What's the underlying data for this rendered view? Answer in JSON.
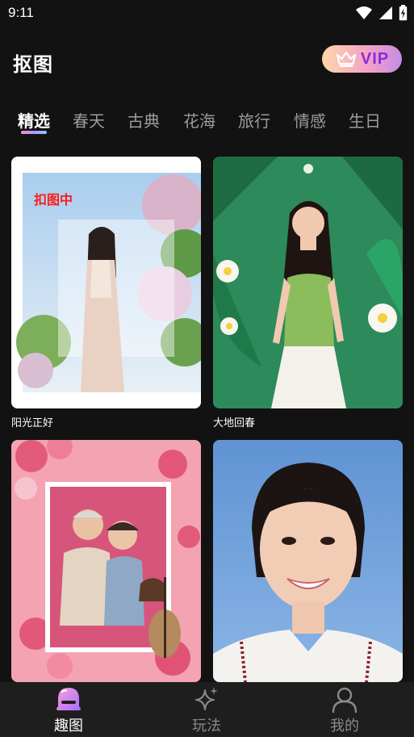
{
  "status": {
    "time": "9:11"
  },
  "header": {
    "title": "抠图",
    "vip_label": "VIP"
  },
  "tabs": [
    {
      "label": "精选",
      "active": true
    },
    {
      "label": "春天"
    },
    {
      "label": "古典"
    },
    {
      "label": "花海"
    },
    {
      "label": "旅行"
    },
    {
      "label": "情感"
    },
    {
      "label": "生日"
    }
  ],
  "cards": [
    {
      "title": "阳光正好",
      "badge": "扣图中"
    },
    {
      "title": "大地回春"
    },
    {
      "title": ""
    },
    {
      "title": ""
    }
  ],
  "bottom_nav": [
    {
      "label": "趣图",
      "active": true,
      "icon": "ghost-icon"
    },
    {
      "label": "玩法",
      "icon": "sparkle-icon"
    },
    {
      "label": "我的",
      "icon": "person-icon"
    }
  ],
  "colors": {
    "accent": "#8e2bd6",
    "background": "#121212",
    "nav_bg": "#1e1e1e"
  }
}
